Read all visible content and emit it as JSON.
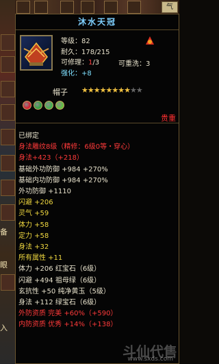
{
  "top_right_tab": "气",
  "side_labels": [
    "备",
    "眼",
    "入"
  ],
  "item": {
    "name": "沐水天冠",
    "level_label": "等级：",
    "level": "82",
    "durability_label": "耐久：",
    "durability": "178/215",
    "repair_label": "可修理：",
    "repair_used": "1",
    "repair_total": "/3",
    "rewash_label": "可重洗：",
    "rewash": "3",
    "enhance_label": "强化：",
    "enhance": "+8",
    "type": "帽子",
    "stars_total": 10,
    "stars_filled": 8,
    "gem_colors": [
      "#d02030",
      "#30a040",
      "#40b050",
      "#60c040"
    ],
    "precious": "贵重"
  },
  "lines": [
    {
      "text": "已绑定",
      "color": "white"
    },
    {
      "text": "身法雕纹8级（精修：6级0等・穿心）",
      "color": "red"
    },
    {
      "text": "身法+423（+218）",
      "color": "red"
    },
    {
      "text": "基础外功防御 +984 +270%",
      "color": "white",
      "extra": ""
    },
    {
      "text": "基础内功防御 +984 +270%",
      "color": "white"
    },
    {
      "text": "外功防御 +1110",
      "color": "white"
    },
    {
      "text": "闪避 +206",
      "color": "yellow"
    },
    {
      "text": "灵气 +59",
      "color": "yellow"
    },
    {
      "text": "体力 +58",
      "color": "yellow"
    },
    {
      "text": "定力 +58",
      "color": "yellow"
    },
    {
      "text": "身法 +32",
      "color": "yellow"
    },
    {
      "text": "所有属性 +11",
      "color": "yellow"
    },
    {
      "text": "体力 +206 红宝石（6级）",
      "color": "white"
    },
    {
      "text": "闪避 +494 祖母绿（6级）",
      "color": "white"
    },
    {
      "text": "玄抗性 +50 纯净黄玉（5级）",
      "color": "white"
    },
    {
      "text": "身法 +112 绿宝石（6级）",
      "color": "white"
    },
    {
      "text": "外防资质  完美 +60%（+590）",
      "color": "red"
    },
    {
      "text": "内防资质  优秀 +14%（+138）",
      "color": "red"
    }
  ],
  "watermark": "斗仙代售",
  "watermark_url": "www.sxds.com"
}
